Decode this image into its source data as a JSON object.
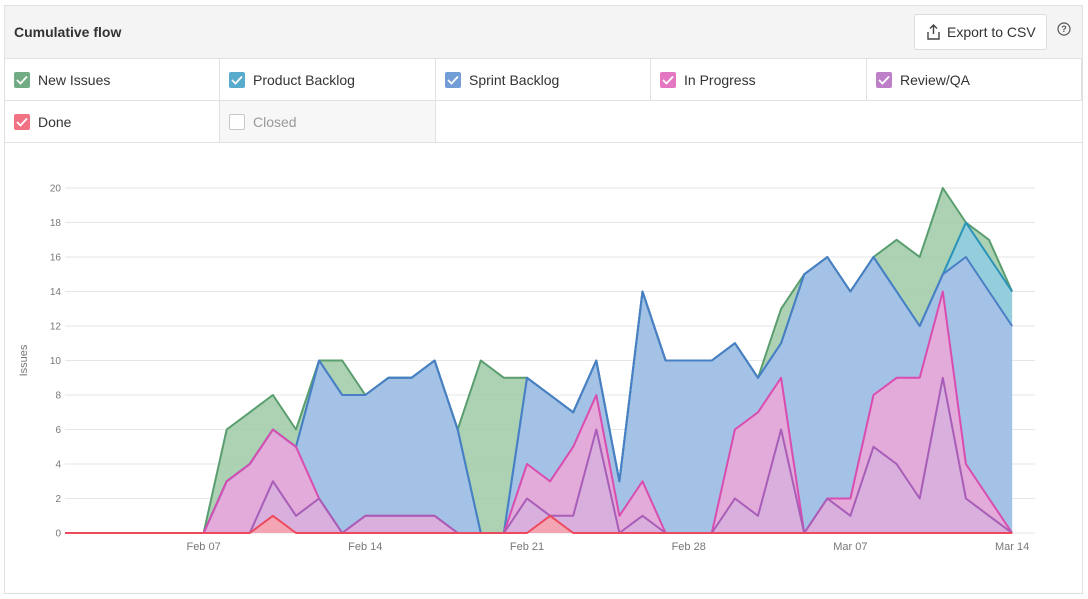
{
  "header": {
    "title": "Cumulative flow",
    "export_label": "Export to CSV",
    "help_icon": "help-circle-icon",
    "export_icon": "upload-icon"
  },
  "legend": [
    {
      "label": "New Issues",
      "checked": true,
      "color": "#5a9e6f"
    },
    {
      "label": "Product Backlog",
      "checked": true,
      "color": "#3b9dc4"
    },
    {
      "label": "Sprint Backlog",
      "checked": true,
      "color": "#5b8dd1"
    },
    {
      "label": "In Progress",
      "checked": true,
      "color": "#e060b8"
    },
    {
      "label": "Review/QA",
      "checked": true,
      "color": "#b36cc0"
    },
    {
      "label": "Done",
      "checked": true,
      "color": "#ee5a6e"
    },
    {
      "label": "Closed",
      "checked": false,
      "color": "#cccccc"
    }
  ],
  "chart_data": {
    "type": "area",
    "ylabel": "Issues",
    "ylim": [
      0,
      20
    ],
    "yticks": [
      0,
      2,
      4,
      6,
      8,
      10,
      12,
      14,
      16,
      18,
      20
    ],
    "xticks": [
      "Feb 07",
      "Feb 14",
      "Feb 21",
      "Feb 28",
      "Mar 07",
      "Mar 14"
    ],
    "x": [
      "Feb 01",
      "Feb 02",
      "Feb 03",
      "Feb 04",
      "Feb 05",
      "Feb 06",
      "Feb 07",
      "Feb 08",
      "Feb 09",
      "Feb 10",
      "Feb 11",
      "Feb 12",
      "Feb 13",
      "Feb 14",
      "Feb 15",
      "Feb 16",
      "Feb 17",
      "Feb 18",
      "Feb 19",
      "Feb 20",
      "Feb 21",
      "Feb 22",
      "Feb 23",
      "Feb 24",
      "Feb 25",
      "Feb 26",
      "Feb 27",
      "Feb 28",
      "Mar 01",
      "Mar 02",
      "Mar 03",
      "Mar 04",
      "Mar 05",
      "Mar 06",
      "Mar 07",
      "Mar 08",
      "Mar 09",
      "Mar 10",
      "Mar 11",
      "Mar 12",
      "Mar 13",
      "Mar 14",
      "Mar 15"
    ],
    "series": [
      {
        "name": "New Issues",
        "color": "#5a9e6f",
        "fill": "#9ecaa6",
        "values": [
          0,
          0,
          0,
          0,
          0,
          0,
          0,
          6,
          7,
          8,
          6,
          10,
          10,
          8,
          9,
          9,
          10,
          6,
          10,
          9,
          9,
          8,
          7,
          10,
          3,
          14,
          10,
          10,
          10,
          11,
          9,
          13,
          15,
          16,
          14,
          16,
          17,
          16,
          20,
          18,
          17,
          14
        ]
      },
      {
        "name": "Product Backlog",
        "color": "#2a93b8",
        "fill": "#8fcde3",
        "values": [
          0,
          0,
          0,
          0,
          0,
          0,
          0,
          3,
          4,
          6,
          5,
          10,
          8,
          8,
          9,
          9,
          10,
          6,
          0,
          0,
          9,
          8,
          7,
          10,
          3,
          14,
          10,
          10,
          10,
          11,
          9,
          11,
          15,
          16,
          14,
          16,
          14,
          12,
          15,
          18,
          16,
          14
        ]
      },
      {
        "name": "Sprint Backlog",
        "color": "#4a7fc5",
        "fill": "#a7c0e6",
        "values": [
          0,
          0,
          0,
          0,
          0,
          0,
          0,
          3,
          4,
          6,
          5,
          10,
          8,
          8,
          9,
          9,
          10,
          6,
          0,
          0,
          9,
          8,
          7,
          10,
          3,
          14,
          10,
          10,
          10,
          11,
          9,
          11,
          15,
          16,
          14,
          16,
          14,
          12,
          15,
          16,
          14,
          12
        ]
      },
      {
        "name": "In Progress",
        "color": "#d94db0",
        "fill": "#eda7d7",
        "values": [
          0,
          0,
          0,
          0,
          0,
          0,
          0,
          3,
          4,
          6,
          5,
          2,
          0,
          1,
          1,
          1,
          1,
          0,
          0,
          0,
          4,
          3,
          5,
          8,
          1,
          3,
          0,
          0,
          0,
          6,
          7,
          9,
          0,
          2,
          2,
          8,
          9,
          9,
          14,
          4,
          2,
          0
        ]
      },
      {
        "name": "Review/QA",
        "color": "#a85db8",
        "fill": "#d7b0dd",
        "values": [
          0,
          0,
          0,
          0,
          0,
          0,
          0,
          0,
          0,
          3,
          1,
          2,
          0,
          1,
          1,
          1,
          1,
          0,
          0,
          0,
          2,
          1,
          1,
          6,
          0,
          1,
          0,
          0,
          0,
          2,
          1,
          6,
          0,
          2,
          1,
          5,
          4,
          2,
          9,
          2,
          1,
          0
        ]
      },
      {
        "name": "Done",
        "color": "#ee4a5e",
        "fill": "#f7a3ad",
        "values": [
          0,
          0,
          0,
          0,
          0,
          0,
          0,
          0,
          0,
          1,
          0,
          0,
          0,
          0,
          0,
          0,
          0,
          0,
          0,
          0,
          0,
          1,
          0,
          0,
          0,
          0,
          0,
          0,
          0,
          0,
          0,
          0,
          0,
          0,
          0,
          0,
          0,
          0,
          0,
          0,
          0,
          0
        ]
      }
    ]
  }
}
